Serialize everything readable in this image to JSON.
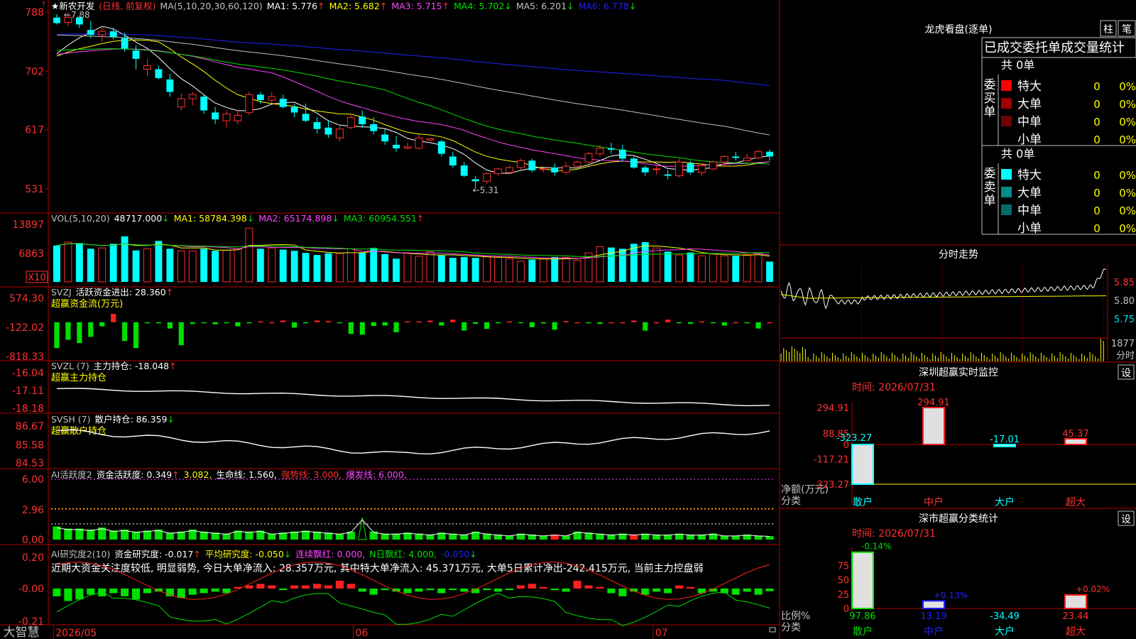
{
  "stock": {
    "name": "★新农开发",
    "period_tag": "(日线, 前复权)",
    "bottom_brand": "大智慧"
  },
  "main_panel": {
    "ma_legend": [
      {
        "text": "MA(5,10,20,30,60,120)",
        "color": "#c0c0c0"
      },
      {
        "text": "MA1: 5.776",
        "color": "#ffffff",
        "arrow": "↑",
        "arrow_color": "#ff3030"
      },
      {
        "text": "MA2: 5.682",
        "color": "#ffff00",
        "arrow": "↑",
        "arrow_color": "#ff3030"
      },
      {
        "text": "MA3: 5.715",
        "color": "#ff44ff",
        "arrow": "↑",
        "arrow_color": "#ff3030"
      },
      {
        "text": "MA4: 5.702",
        "color": "#00e000",
        "arrow": "↓",
        "arrow_color": "#00e000"
      },
      {
        "text": "MA5: 6.201",
        "color": "#c0c0c0",
        "arrow": "↓",
        "arrow_color": "#00e000"
      },
      {
        "text": "MA6: 6.778",
        "color": "#2020ff",
        "arrow": "↓",
        "arrow_color": "#00e000"
      }
    ],
    "y_labels": [
      "788",
      "702",
      "617",
      "531"
    ],
    "hi_note": "←7.88",
    "lo_note": "←5.31"
  },
  "vol_panel": {
    "legend": [
      {
        "text": "VOL(5,10,20)",
        "color": "#c0c0c0"
      },
      {
        "text": "48717.000",
        "color": "#ffffff",
        "arrow": "↓",
        "arrow_color": "#00e000"
      },
      {
        "text": "MA1: 58784.398",
        "color": "#ffff00",
        "arrow": "↓",
        "arrow_color": "#00e000"
      },
      {
        "text": "MA2: 65174.898",
        "color": "#ff44ff",
        "arrow": "↓",
        "arrow_color": "#00e000"
      },
      {
        "text": "MA3: 60954.551",
        "color": "#00e000",
        "arrow": "↑",
        "arrow_color": "#ff3030"
      }
    ],
    "y_labels": [
      "13897",
      "6863"
    ],
    "unit": "X10"
  },
  "svzj_panel": {
    "legend": [
      {
        "text": "SVZJ",
        "color": "#c0c0c0"
      },
      {
        "text": "活跃资金进出: 28.360",
        "color": "#ffffff",
        "arrow": "↑",
        "arrow_color": "#ff3030"
      }
    ],
    "subtitle": "超赢资金流(万元)",
    "y_labels": [
      "574.30",
      "-122.02",
      "-818.33"
    ]
  },
  "svzl_panel": {
    "legend": [
      {
        "text": "SVZL (7)",
        "color": "#c0c0c0"
      },
      {
        "text": "主力持仓: -18.048",
        "color": "#ffffff",
        "arrow": "↑",
        "arrow_color": "#ff3030"
      }
    ],
    "subtitle": "超赢主力持仓",
    "y_labels": [
      "-16.04",
      "-17.11",
      "-18.18"
    ]
  },
  "svsh_panel": {
    "legend": [
      {
        "text": "SVSH (7)",
        "color": "#c0c0c0"
      },
      {
        "text": "散户持仓: 86.359",
        "color": "#ffffff",
        "arrow": "↓",
        "arrow_color": "#00e000"
      }
    ],
    "subtitle": "超赢散户持仓",
    "y_labels": [
      "86.67",
      "85.58",
      "84.53"
    ]
  },
  "ai1_panel": {
    "legend": [
      {
        "text": "AI活跃度2",
        "color": "#c0c0c0"
      },
      {
        "text": "资金活跃度: 0.349",
        "color": "#ffffff",
        "arrow": "↑",
        "arrow_color": "#ff3030"
      },
      {
        "text": "3.082,",
        "color": "#ffff00"
      },
      {
        "text": "生命线: 1.560,",
        "color": "#ffffff"
      },
      {
        "text": "强势线: 3.000,",
        "color": "#ff3030"
      },
      {
        "text": "爆发线: 6.000,",
        "color": "#ff44ff"
      }
    ],
    "y_labels": [
      "6.00",
      "2.96",
      "0.00"
    ]
  },
  "ai2_panel": {
    "legend": [
      {
        "text": "AI研究度2(10)",
        "color": "#c0c0c0"
      },
      {
        "text": "资金研究度: -0.017",
        "color": "#ffffff",
        "arrow": "↑",
        "arrow_color": "#ff3030"
      },
      {
        "text": "平均研究度: -0.050",
        "color": "#ffff00",
        "arrow": "↓",
        "arrow_color": "#00e000"
      },
      {
        "text": "连续飘红: 0.000,",
        "color": "#ff44ff"
      },
      {
        "text": "N日飘红: 4.000,",
        "color": "#00e000"
      },
      {
        "text": "-0.050",
        "color": "#2020ff",
        "arrow": "↓",
        "arrow_color": "#00e000"
      }
    ],
    "comment": "近期大资金关注度较低, 明显弱势, 今日大单净流入: 28.357万元, 其中特大单净流入: 45.371万元, 大单5日累计净出-242.415万元, 当前主力控盘弱",
    "y_labels": [
      "0.20",
      "-0.00",
      "-0.21"
    ]
  },
  "x_axis": {
    "labels": [
      "2026/05",
      "06",
      "07"
    ]
  },
  "right_top": {
    "title": "龙虎看盘(逐单)",
    "btn_zhu": "柱",
    "btn_bi": "笔",
    "header": "已成交委托单成交量统计",
    "buy_label": "委买单",
    "sell_label": "委卖单",
    "buy_total": "共 0单",
    "sell_total": "共 0单",
    "buy_rows": [
      {
        "name": "特大",
        "val": "0",
        "pct": "0%",
        "color": "#ff0000"
      },
      {
        "name": "大单",
        "val": "0",
        "pct": "0%",
        "color": "#a00000"
      },
      {
        "name": "中单",
        "val": "0",
        "pct": "0%",
        "color": "#700000"
      },
      {
        "name": "小单",
        "val": "0",
        "pct": "0%",
        "color": ""
      }
    ],
    "sell_rows": [
      {
        "name": "特大",
        "val": "0",
        "pct": "0%",
        "color": "#00ffff"
      },
      {
        "name": "大单",
        "val": "0",
        "pct": "0%",
        "color": "#008b8b"
      },
      {
        "name": "中单",
        "val": "0",
        "pct": "0%",
        "color": "#006b6b"
      },
      {
        "name": "小单",
        "val": "0",
        "pct": "0%",
        "color": ""
      }
    ]
  },
  "intraday": {
    "title": "分时走势",
    "y_labels": [
      "5.85",
      "5.80",
      "5.75"
    ],
    "vol_label": "1877",
    "unit_label": "分时"
  },
  "sz_monitor": {
    "title": "深圳超赢实时监控",
    "settings": "设",
    "time": "时间: 2026/07/31",
    "y_labels": [
      "294.91",
      "88.85",
      "0",
      "-117.21",
      "-323.27"
    ],
    "unit_top": "净额(万元)",
    "unit_bottom": "分类",
    "categories": [
      "散户",
      "中户",
      "大户",
      "超大"
    ],
    "values": [
      -323.27,
      294.91,
      -17.01,
      45.37
    ],
    "value_labels": [
      "-323.27",
      "294.91",
      "-17.01",
      "45.37"
    ]
  },
  "sz_class": {
    "title": "深市超赢分类统计",
    "settings": "设",
    "time": "时间: 2026/07/31",
    "y_labels": [
      "75",
      "50",
      "25",
      "0"
    ],
    "unit_top": "比例%",
    "unit_bottom": "分类",
    "categories": [
      "散户",
      "中户",
      "大户",
      "超大"
    ],
    "top_labels": [
      "-0.14%",
      "+0.13%",
      "",
      "+0.02%"
    ],
    "values": [
      97.86,
      13.19,
      -34.49,
      23.44
    ],
    "value_labels": [
      "97.86",
      "13.19",
      "-34.49",
      "23.44"
    ]
  },
  "colors": {
    "up": "#ff3030",
    "down": "#00ffff",
    "border": "#b00000",
    "axis_text": "#ff3030"
  },
  "chart_data": {
    "type": "candlestick",
    "dates_range": [
      "2026/05",
      "2026/07/31"
    ],
    "ohlc": [
      [
        7.8,
        7.85,
        7.7,
        7.72
      ],
      [
        7.73,
        7.88,
        7.68,
        7.8
      ],
      [
        7.8,
        7.82,
        7.65,
        7.7
      ],
      [
        7.62,
        7.75,
        7.5,
        7.55
      ],
      [
        7.55,
        7.68,
        7.45,
        7.6
      ],
      [
        7.6,
        7.65,
        7.48,
        7.52
      ],
      [
        7.5,
        7.58,
        7.3,
        7.35
      ],
      [
        7.32,
        7.4,
        7.05,
        7.2
      ],
      [
        7.05,
        7.2,
        6.95,
        7.1
      ],
      [
        7.05,
        7.1,
        6.9,
        6.92
      ],
      [
        6.9,
        6.98,
        6.65,
        6.72
      ],
      [
        6.5,
        6.7,
        6.45,
        6.62
      ],
      [
        6.62,
        6.72,
        6.52,
        6.68
      ],
      [
        6.65,
        6.68,
        6.4,
        6.45
      ],
      [
        6.42,
        6.5,
        6.25,
        6.32
      ],
      [
        6.3,
        6.45,
        6.2,
        6.4
      ],
      [
        6.3,
        6.45,
        6.25,
        6.38
      ],
      [
        6.42,
        6.72,
        6.38,
        6.68
      ],
      [
        6.68,
        6.72,
        6.55,
        6.6
      ],
      [
        6.6,
        6.72,
        6.55,
        6.65
      ],
      [
        6.62,
        6.68,
        6.48,
        6.5
      ],
      [
        6.5,
        6.55,
        6.35,
        6.42
      ],
      [
        6.4,
        6.55,
        6.28,
        6.3
      ],
      [
        6.28,
        6.35,
        6.12,
        6.18
      ],
      [
        6.2,
        6.3,
        6.05,
        6.1
      ],
      [
        6.05,
        6.25,
        6.0,
        6.18
      ],
      [
        6.2,
        6.38,
        6.18,
        6.35
      ],
      [
        6.36,
        6.45,
        6.2,
        6.25
      ],
      [
        6.25,
        6.35,
        6.1,
        6.15
      ],
      [
        6.1,
        6.18,
        5.95,
        6.0
      ],
      [
        5.95,
        6.08,
        5.85,
        5.9
      ],
      [
        5.9,
        5.98,
        5.88,
        5.92
      ],
      [
        5.9,
        6.1,
        5.88,
        6.05
      ],
      [
        6.02,
        6.05,
        6.0,
        6.04
      ],
      [
        6.0,
        6.02,
        5.78,
        5.82
      ],
      [
        5.78,
        5.85,
        5.62,
        5.65
      ],
      [
        5.65,
        5.7,
        5.48,
        5.5
      ],
      [
        5.45,
        5.5,
        5.31,
        5.42
      ],
      [
        5.42,
        5.55,
        5.38,
        5.53
      ],
      [
        5.53,
        5.62,
        5.5,
        5.6
      ],
      [
        5.55,
        5.65,
        5.52,
        5.62
      ],
      [
        5.62,
        5.75,
        5.58,
        5.72
      ],
      [
        5.72,
        5.75,
        5.55,
        5.58
      ],
      [
        5.6,
        5.62,
        5.55,
        5.6
      ],
      [
        5.62,
        5.68,
        5.5,
        5.55
      ],
      [
        5.55,
        5.7,
        5.52,
        5.64
      ],
      [
        5.64,
        5.72,
        5.6,
        5.7
      ],
      [
        5.7,
        5.85,
        5.68,
        5.82
      ],
      [
        5.82,
        5.95,
        5.78,
        5.9
      ],
      [
        5.9,
        5.98,
        5.82,
        5.88
      ],
      [
        5.88,
        5.95,
        5.7,
        5.75
      ],
      [
        5.75,
        5.78,
        5.6,
        5.62
      ],
      [
        5.62,
        5.65,
        5.5,
        5.55
      ],
      [
        5.6,
        5.65,
        5.52,
        5.6
      ],
      [
        5.52,
        5.58,
        5.45,
        5.5
      ],
      [
        5.5,
        5.75,
        5.48,
        5.7
      ],
      [
        5.68,
        5.72,
        5.52,
        5.55
      ],
      [
        5.55,
        5.68,
        5.5,
        5.65
      ],
      [
        5.6,
        5.72,
        5.58,
        5.7
      ],
      [
        5.7,
        5.8,
        5.65,
        5.78
      ],
      [
        5.78,
        5.85,
        5.72,
        5.76
      ],
      [
        5.72,
        5.82,
        5.7,
        5.76
      ],
      [
        5.76,
        5.88,
        5.74,
        5.85
      ],
      [
        5.85,
        5.88,
        5.72,
        5.78
      ]
    ],
    "volume": [
      8800,
      9600,
      9400,
      8000,
      8200,
      9200,
      11000,
      7600,
      8000,
      9900,
      8000,
      7500,
      7500,
      8000,
      7500,
      7700,
      8000,
      13000,
      8000,
      8200,
      7800,
      7500,
      7000,
      6500,
      6900,
      6900,
      8000,
      7000,
      8200,
      6700,
      5600,
      7000,
      6200,
      7300,
      6400,
      5800,
      6000,
      5800,
      6200,
      6000,
      5600,
      5000,
      5400,
      5600,
      6000,
      5900,
      5200,
      7000,
      8500,
      8300,
      8000,
      9200,
      9600,
      8200,
      7300,
      6500,
      7100,
      6300,
      6700,
      6300,
      6300,
      6600,
      7000,
      4900
    ],
    "svzj": [
      -620,
      -420,
      -500,
      -350,
      -100,
      200,
      -450,
      -620,
      -20,
      -20,
      -150,
      -550,
      -40,
      -5,
      -50,
      -20,
      -100,
      -20,
      20,
      0,
      40,
      -130,
      -10,
      40,
      30,
      -5,
      -280,
      -300,
      -90,
      -80,
      -240,
      20,
      20,
      40,
      -80,
      60,
      -200,
      -40,
      -160,
      -20,
      20,
      -5,
      -120,
      -30,
      -180,
      30,
      0,
      -5,
      -40,
      0,
      0,
      40,
      -200,
      0,
      60,
      -5,
      -40,
      20,
      -20,
      -80,
      0,
      -20,
      -150,
      0
    ],
    "ai_activity": [
      1.3,
      1.1,
      1.1,
      1.0,
      1.2,
      0.9,
      1.0,
      0.8,
      0.9,
      1.0,
      0.7,
      0.8,
      1.0,
      0.8,
      0.7,
      0.6,
      0.9,
      0.8,
      0.9,
      0.6,
      0.7,
      0.8,
      0.9,
      0.8,
      0.7,
      0.6,
      0.8,
      2.2,
      0.8,
      0.6,
      0.6,
      0.7,
      0.6,
      0.5,
      0.7,
      0.6,
      0.5,
      0.8,
      0.6,
      0.5,
      0.4,
      0.6,
      0.5,
      0.4,
      0.5,
      0.4,
      0.8,
      0.7,
      0.6,
      0.5,
      0.6,
      0.5,
      0.6,
      0.5,
      0.5,
      0.6,
      0.5,
      0.5,
      0.6,
      0.4,
      0.4,
      0.5,
      0.4,
      0.35
    ],
    "ai_research": [
      -0.05,
      -0.08,
      -0.07,
      -0.04,
      -0.05,
      -0.03,
      -0.05,
      -0.07,
      -0.03,
      -0.02,
      -0.05,
      -0.06,
      -0.04,
      -0.03,
      -0.02,
      -0.03,
      0.01,
      0.02,
      0.03,
      0.02,
      -0.01,
      0.02,
      0.02,
      0.03,
      0.02,
      0.05,
      0.03,
      -0.02,
      -0.04,
      -0.01,
      -0.02,
      -0.03,
      -0.02,
      -0.01,
      -0.03,
      -0.01,
      -0.02,
      -0.03,
      -0.01,
      -0.02,
      -0.01,
      0.02,
      0.03,
      0.01,
      -0.01,
      -0.02,
      0.05,
      0.02,
      0.01,
      -0.03,
      -0.05,
      -0.02,
      -0.04,
      -0.02,
      -0.03,
      0.02,
      0.01,
      -0.03,
      -0.02,
      -0.03,
      -0.04,
      -0.02,
      -0.04,
      -0.017
    ]
  }
}
